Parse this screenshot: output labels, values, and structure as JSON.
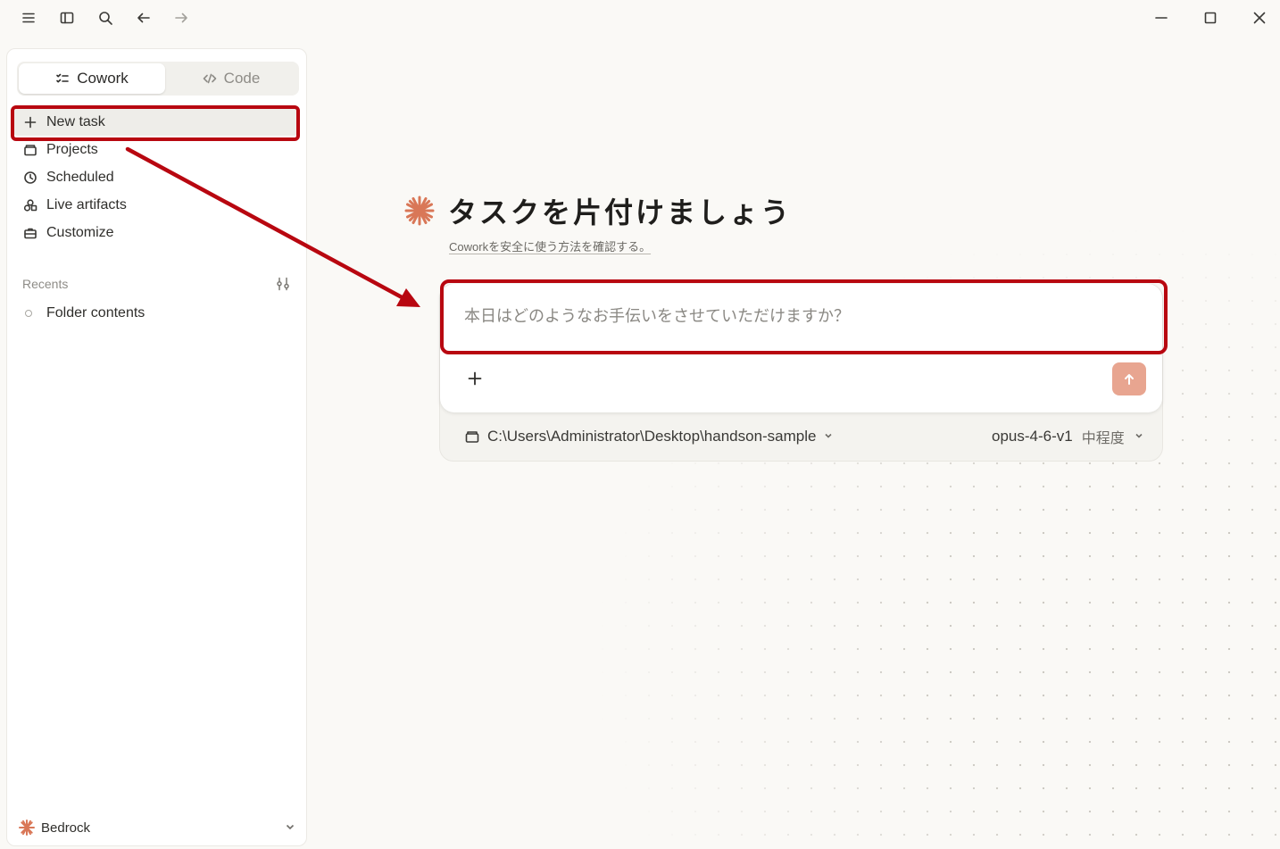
{
  "colors": {
    "accent": "#d97757",
    "send_button": "#e8a590",
    "annotation": "#b80710"
  },
  "titlebar": {
    "icons": [
      "menu-icon",
      "sidebar-toggle-icon",
      "search-icon",
      "back-arrow-icon",
      "forward-arrow-icon"
    ],
    "window_controls": [
      "minimize-icon",
      "maximize-icon",
      "close-icon"
    ]
  },
  "sidebar": {
    "modes": [
      {
        "label": "Cowork",
        "icon": "checklist-icon",
        "active": true
      },
      {
        "label": "Code",
        "icon": "code-icon",
        "active": false
      }
    ],
    "nav": [
      {
        "label": "New task",
        "icon": "plus-icon"
      },
      {
        "label": "Projects",
        "icon": "folder-icon"
      },
      {
        "label": "Scheduled",
        "icon": "clock-icon"
      },
      {
        "label": "Live artifacts",
        "icon": "artifacts-icon"
      },
      {
        "label": "Customize",
        "icon": "briefcase-icon"
      }
    ],
    "recents_label": "Recents",
    "recents": [
      {
        "label": "Folder contents"
      }
    ],
    "account": {
      "label": "Bedrock",
      "icon": "claude-spark-icon"
    }
  },
  "main": {
    "title": "タスクを片付けましょう",
    "subtitle_link": "Coworkを安全に使う方法を確認する。",
    "input_placeholder": "本日はどのようなお手伝いをさせていただけますか？",
    "input_value": "",
    "folder": "C:\\Users\\Administrator\\Desktop\\handson-sample",
    "model": "opus-4-6-v1",
    "effort": "中程度"
  }
}
